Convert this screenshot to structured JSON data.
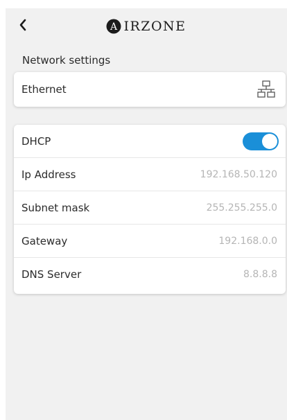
{
  "header": {
    "back_icon": "chevron-left-icon",
    "brand_logo": "airzone-a-logo",
    "brand_logo_letter": "A",
    "brand_text": "IRZONE"
  },
  "section": {
    "title": "Network settings"
  },
  "ethernet": {
    "label": "Ethernet",
    "icon": "network-icon"
  },
  "network": {
    "dhcp": {
      "label": "DHCP",
      "enabled": true,
      "toggle_color": "#1a8fd8"
    },
    "rows": [
      {
        "label": "Ip Address",
        "value": "192.168.50.120"
      },
      {
        "label": "Subnet mask",
        "value": "255.255.255.0"
      },
      {
        "label": "Gateway",
        "value": "192.168.0.0"
      },
      {
        "label": "DNS Server",
        "value": "8.8.8.8"
      }
    ]
  },
  "colors": {
    "background": "#f1f1f1",
    "card": "#ffffff",
    "accent": "#1a8fd8",
    "text": "#2b2b2b",
    "muted": "#b5b5b5"
  }
}
